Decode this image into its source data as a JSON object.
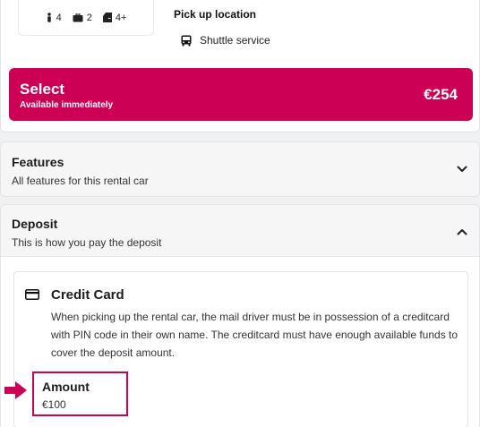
{
  "specs": {
    "passengers": "4",
    "suitcases": "2",
    "doors": "4+"
  },
  "pickup": {
    "title": "Pick up location",
    "service": "Shuttle service"
  },
  "select": {
    "label": "Select",
    "sub": "Available immediately",
    "price": "€254"
  },
  "features": {
    "title": "Features",
    "subtitle": "All features for this rental car"
  },
  "deposit": {
    "title": "Deposit",
    "subtitle": "This is how you pay the deposit",
    "method": {
      "title": "Credit Card",
      "description": "When picking up the rental car, the mail driver must be in possession of a creditcard with PIN code in their own name. The creditcard must have enough available funds to cover the deposit amount.",
      "amount_label": "Amount",
      "amount_value": "€100"
    }
  },
  "colors": {
    "accent": "#cc0055"
  }
}
